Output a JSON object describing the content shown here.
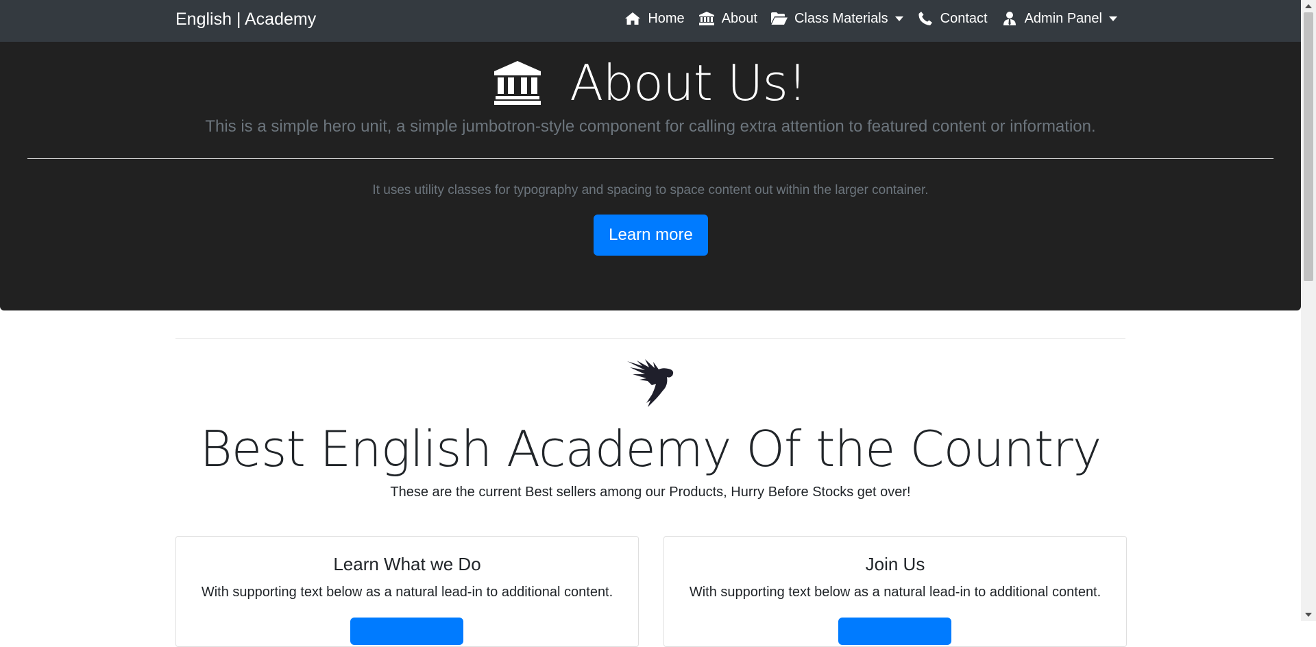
{
  "navbar": {
    "brand": "English | Academy",
    "items": [
      {
        "label": "Home",
        "icon": "home-icon",
        "dropdown": false
      },
      {
        "label": "About",
        "icon": "institution-icon",
        "dropdown": false
      },
      {
        "label": "Class Materials",
        "icon": "folder-open-icon",
        "dropdown": true
      },
      {
        "label": "Contact",
        "icon": "phone-icon",
        "dropdown": false
      },
      {
        "label": "Admin Panel",
        "icon": "user-tie-icon",
        "dropdown": true
      }
    ]
  },
  "jumbotron": {
    "icon": "institution-icon",
    "title": "About Us!",
    "lead": "This is a simple hero unit, a simple jumbotron-style component for calling extra attention to featured content or information.",
    "text": "It uses utility classes for typography and spacing to space content out within the larger container.",
    "button_label": "Learn more"
  },
  "section": {
    "logo_icon": "winged-figure-logo",
    "title": "Best English Academy Of the Country",
    "subtitle": "These are the current Best sellers among our Products, Hurry Before Stocks get over!"
  },
  "cards": [
    {
      "title": "Learn What we Do",
      "text": "With supporting text below as a natural lead-in to additional content."
    },
    {
      "title": "Join Us",
      "text": "With supporting text below as a natural lead-in to additional content."
    }
  ],
  "colors": {
    "navbar_bg": "#343a40",
    "jumbotron_bg": "#212121",
    "primary": "#007bff",
    "muted_text": "#6c757d"
  }
}
